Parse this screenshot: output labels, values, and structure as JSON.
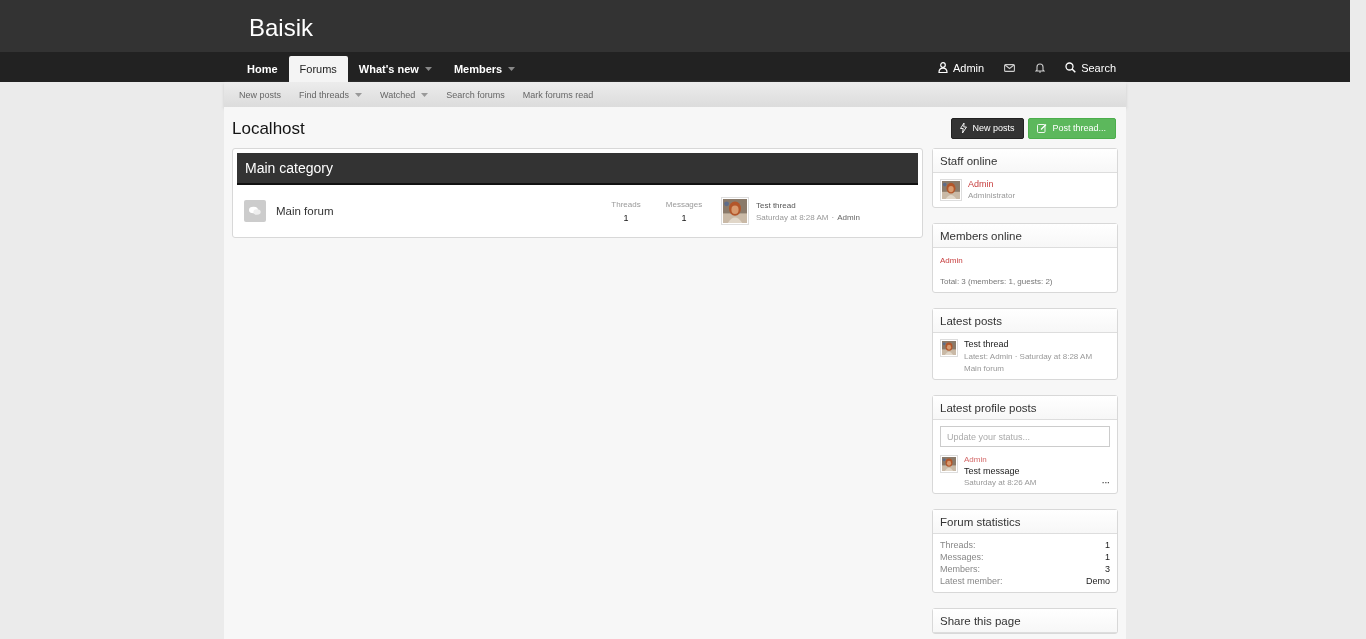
{
  "site": {
    "title": "Baisik"
  },
  "nav": {
    "tabs": [
      {
        "label": "Home",
        "selected": false,
        "dropdown": false
      },
      {
        "label": "Forums",
        "selected": true,
        "dropdown": false
      },
      {
        "label": "What's new",
        "selected": false,
        "dropdown": true
      },
      {
        "label": "Members",
        "selected": false,
        "dropdown": true
      }
    ],
    "user": "Admin",
    "search": "Search"
  },
  "subnav": [
    {
      "label": "New posts",
      "dropdown": false
    },
    {
      "label": "Find threads",
      "dropdown": true
    },
    {
      "label": "Watched",
      "dropdown": true
    },
    {
      "label": "Search forums",
      "dropdown": false
    },
    {
      "label": "Mark forums read",
      "dropdown": false
    }
  ],
  "page": {
    "title": "Localhost",
    "buttons": [
      {
        "label": "New posts",
        "kind": "dark"
      },
      {
        "label": "Post thread...",
        "kind": "green"
      }
    ]
  },
  "category": {
    "title": "Main category",
    "forums": [
      {
        "name": "Main forum",
        "threads_label": "Threads",
        "threads": "1",
        "messages_label": "Messages",
        "messages": "1",
        "last_title": "Test thread",
        "last_date": "Saturday at 8:28 AM",
        "separator": "·",
        "last_user": "Admin"
      }
    ]
  },
  "sidebar": [
    {
      "kind": "staff",
      "title": "Staff online",
      "members": [
        {
          "name": "Admin",
          "role": "Administrator"
        }
      ]
    },
    {
      "kind": "online",
      "title": "Members online",
      "names": [
        "Admin"
      ],
      "total": "Total: 3 (members: 1, guests: 2)"
    },
    {
      "kind": "posts",
      "title": "Latest posts",
      "items": [
        {
          "title": "Test thread",
          "meta": "Latest: Admin · Saturday at 8:28 AM",
          "forum": "Main forum"
        }
      ]
    },
    {
      "kind": "profile",
      "title": "Latest profile posts",
      "placeholder": "Update your status...",
      "items": [
        {
          "user": "Admin",
          "message": "Test message",
          "date": "Saturday at 8:26 AM",
          "more": "···"
        }
      ]
    },
    {
      "kind": "stats",
      "title": "Forum statistics",
      "rows": [
        {
          "label": "Threads:",
          "value": "1"
        },
        {
          "label": "Messages:",
          "value": "1"
        },
        {
          "label": "Members:",
          "value": "3"
        },
        {
          "label": "Latest member:",
          "value": "Demo"
        }
      ]
    },
    {
      "kind": "share",
      "title": "Share this page"
    }
  ]
}
